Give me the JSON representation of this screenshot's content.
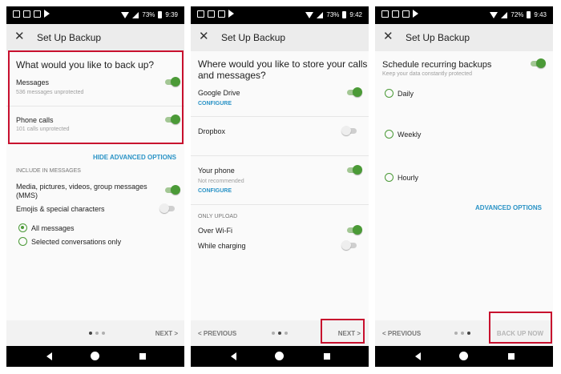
{
  "screens": [
    {
      "status": {
        "battery": "73%",
        "time": "9:39"
      },
      "appbar": {
        "close_glyph": "✕",
        "title": "Set Up Backup"
      },
      "question": "What would you like to back up?",
      "messages": {
        "label": "Messages",
        "sub": "536 messages unprotected",
        "toggle": "on"
      },
      "calls": {
        "label": "Phone calls",
        "sub": "101 calls unprotected",
        "toggle": "on"
      },
      "hide_advanced": "HIDE ADVANCED OPTIONS",
      "include_header": "INCLUDE IN MESSAGES",
      "media": {
        "label_line1": "Media, pictures, videos, group messages",
        "label_line2": "(MMS)",
        "toggle": "on"
      },
      "emojis": {
        "label": "Emojis & special characters",
        "toggle": "off"
      },
      "radio_all": {
        "label": "All messages",
        "checked": true
      },
      "radio_selected": {
        "label": "Selected conversations only",
        "checked": false
      },
      "footer": {
        "next": "NEXT >",
        "page": 1,
        "pages": 3
      }
    },
    {
      "status": {
        "battery": "73%",
        "time": "9:42"
      },
      "appbar": {
        "close_glyph": "✕",
        "title": "Set Up Backup"
      },
      "question_line1": "Where would you like to store your calls",
      "question_line2": "and messages?",
      "drive": {
        "label": "Google Drive",
        "configure": "CONFIGURE",
        "toggle": "on"
      },
      "dropbox": {
        "label": "Dropbox",
        "toggle": "off"
      },
      "phone": {
        "label": "Your phone",
        "sub": "Not recommended",
        "configure": "CONFIGURE",
        "toggle": "on"
      },
      "only_upload": "ONLY UPLOAD",
      "wifi": {
        "label": "Over Wi-Fi",
        "toggle": "on"
      },
      "charging": {
        "label": "While charging",
        "toggle": "off"
      },
      "footer": {
        "previous": "< PREVIOUS",
        "next": "NEXT >",
        "page": 2,
        "pages": 3
      }
    },
    {
      "status": {
        "battery": "72%",
        "time": "9:43"
      },
      "appbar": {
        "close_glyph": "✕",
        "title": "Set Up Backup"
      },
      "schedule": {
        "label": "Schedule recurring backups",
        "sub": "Keep your data constantly protected",
        "toggle": "on"
      },
      "daily": {
        "label": "Daily",
        "checked": false
      },
      "weekly": {
        "label": "Weekly",
        "checked": false
      },
      "hourly": {
        "label": "Hourly",
        "checked": false
      },
      "advanced": "ADVANCED OPTIONS",
      "footer": {
        "previous": "< PREVIOUS",
        "back_up_now": "BACK UP NOW",
        "page": 3,
        "pages": 3
      }
    }
  ],
  "colors": {
    "accent_green": "#4b9a37",
    "link_blue": "#2a93c6",
    "highlight_red": "#c8102e"
  }
}
